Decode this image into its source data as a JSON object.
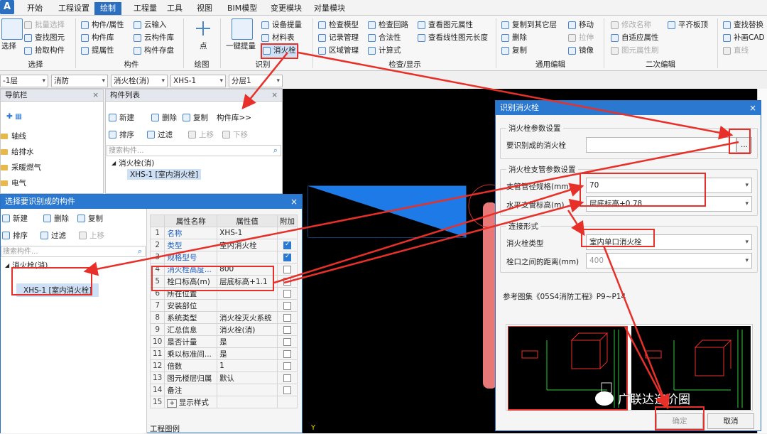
{
  "app": {
    "logo": "A"
  },
  "ribbon_tabs": [
    "开始",
    "工程设置",
    "绘制",
    "工程量",
    "工具",
    "视图",
    "BIM模型",
    "变更模块",
    "对量模块"
  ],
  "ribbon": {
    "select": {
      "big": "选择",
      "items": [
        "批量选择",
        "查找图元",
        "拾取构件"
      ],
      "group": "选择"
    },
    "component": {
      "items": [
        "构件/属性",
        "构件库",
        "提属性",
        "云输入",
        "云构件库",
        "构件存盘"
      ],
      "group": "构件"
    },
    "draw": {
      "big": "点",
      "group": "绘图"
    },
    "recognize": {
      "big": "一键提量",
      "items": [
        "设备提量",
        "材料表",
        "消火栓"
      ],
      "group": "识别"
    },
    "check": {
      "items": [
        "检查模型",
        "记录管理",
        "区域管理",
        "检查回路",
        "合法性",
        "计算式",
        "查看图元属性",
        "查看线性图元长度"
      ],
      "group": "检查/显示"
    },
    "edit": {
      "items": [
        "复制到其它层",
        "删除",
        "复制",
        "移动",
        "拉伸",
        "镜像"
      ],
      "group": "通用编辑"
    },
    "second": {
      "items": [
        "修改名称",
        "自适应属性",
        "图元属性刷",
        "平齐板顶"
      ],
      "group": "二次编辑"
    },
    "extra": {
      "items": [
        "查找替换",
        "补画CAD",
        "直线"
      ]
    }
  },
  "selector_bar": [
    "-1层",
    "消防",
    "消火栓(消)",
    "XHS-1",
    "分层1"
  ],
  "nav_panel": {
    "title": "导航栏",
    "items": [
      "轴线",
      "给排水",
      "采暖燃气",
      "电气"
    ]
  },
  "comp_list": {
    "title": "构件列表",
    "toolbar": [
      "新建",
      "删除",
      "复制",
      "构件库>>"
    ],
    "toolbar2": [
      "排序",
      "过滤",
      "上移",
      "下移"
    ],
    "search_placeholder": "搜索构件...",
    "tree_root": "消火栓(消)",
    "tree_item": "XHS-1 [室内消火栓]"
  },
  "select_dialog": {
    "title": "选择要识别成的构件",
    "toolbar": [
      "新建",
      "删除",
      "复制"
    ],
    "toolbar2": [
      "排序",
      "过滤",
      "上移"
    ],
    "search_placeholder": "搜索构件...",
    "tree_root": "消火栓(消)",
    "tree_item": "XHS-1 [室内消火栓]",
    "legend": "工程图例",
    "prop_headers": [
      "属性名称",
      "属性值",
      "附加"
    ],
    "props": [
      {
        "n": "1",
        "name": "名称",
        "value": "XHS-1",
        "chk": "none",
        "blue": true
      },
      {
        "n": "2",
        "name": "类型",
        "value": "室内消火栓",
        "chk": "on",
        "blue": true
      },
      {
        "n": "3",
        "name": "规格型号",
        "value": "",
        "chk": "on",
        "blue": true
      },
      {
        "n": "4",
        "name": "消火栓高度...",
        "value": "800",
        "chk": "off",
        "blue": true
      },
      {
        "n": "5",
        "name": "栓口标高(m)",
        "value": "层底标高+1.1",
        "chk": "off",
        "blue": false
      },
      {
        "n": "6",
        "name": "所在位置",
        "value": "",
        "chk": "off",
        "blue": false
      },
      {
        "n": "7",
        "name": "安装部位",
        "value": "",
        "chk": "off",
        "blue": false
      },
      {
        "n": "8",
        "name": "系统类型",
        "value": "消火栓灭火系统",
        "chk": "off",
        "blue": false
      },
      {
        "n": "9",
        "name": "汇总信息",
        "value": "消火栓(消)",
        "chk": "off",
        "blue": false
      },
      {
        "n": "10",
        "name": "是否计量",
        "value": "是",
        "chk": "off",
        "blue": false
      },
      {
        "n": "11",
        "name": "乘以标准间...",
        "value": "是",
        "chk": "off",
        "blue": false
      },
      {
        "n": "12",
        "name": "倍数",
        "value": "1",
        "chk": "off",
        "blue": false
      },
      {
        "n": "13",
        "name": "图元楼层归属",
        "value": "默认",
        "chk": "off",
        "blue": false
      },
      {
        "n": "14",
        "name": "备注",
        "value": "",
        "chk": "off",
        "blue": false
      },
      {
        "n": "15",
        "name": "显示样式",
        "value": "",
        "chk": "none",
        "blue": false,
        "expand": "+"
      }
    ]
  },
  "recog_dialog": {
    "title": "识别消火栓",
    "g1_title": "消火栓参数设置",
    "target_label": "要识别成的消火栓",
    "target_value": "",
    "browse": "...",
    "g2_title": "消火栓支管参数设置",
    "pipe_spec_label": "支管管径规格(mm)",
    "pipe_spec_value": "70",
    "pipe_height_label": "水平支管标高(m)",
    "pipe_height_value": "层底标高+0.78",
    "g3_title": "连接形式",
    "type_label": "消火栓类型",
    "type_value": "室内单口消火栓",
    "dist_label": "栓口之间的距离(mm)",
    "dist_value": "400",
    "atlas": "参考图集《05S4消防工程》P9~P14",
    "ok": "确定",
    "cancel": "取消"
  },
  "watermark": "广联达造价圈",
  "colors": {
    "accent": "#2b78d0",
    "red": "#e8302a",
    "cad_bg": "#000000",
    "shape_blue": "#1e7ae6"
  }
}
